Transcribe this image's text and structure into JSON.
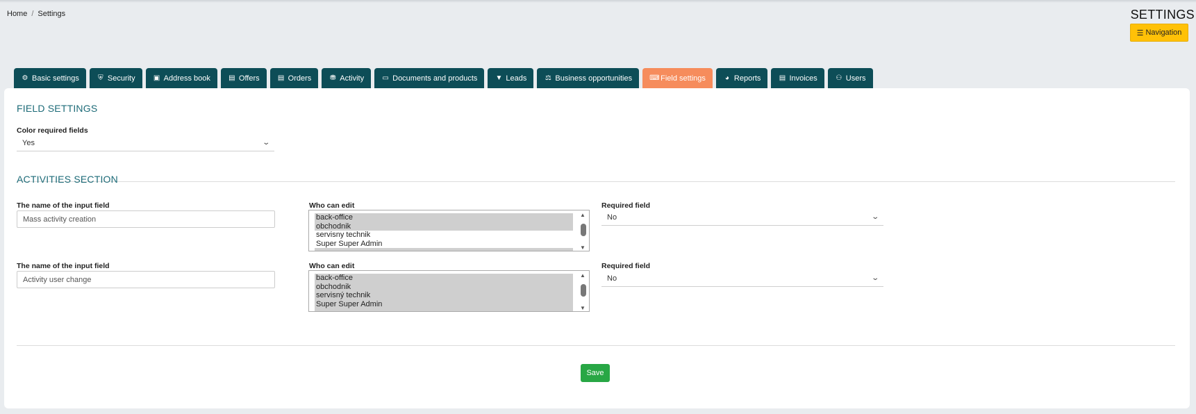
{
  "breadcrumb": {
    "home": "Home",
    "separator": "/",
    "current": "Settings"
  },
  "header": {
    "title": "SETTINGS",
    "nav_button": "Navigation",
    "nav_icon": "bars-icon"
  },
  "tabs": [
    {
      "label": "Basic settings",
      "icon": "gears-icon"
    },
    {
      "label": "Security",
      "icon": "shield-icon"
    },
    {
      "label": "Address book",
      "icon": "address-card-icon"
    },
    {
      "label": "Offers",
      "icon": "file-icon"
    },
    {
      "label": "Orders",
      "icon": "file-icon"
    },
    {
      "label": "Activity",
      "icon": "truck-icon"
    },
    {
      "label": "Documents and products",
      "icon": "folder-open-icon"
    },
    {
      "label": "Leads",
      "icon": "filter-icon"
    },
    {
      "label": "Business opportunities",
      "icon": "balance-scale-icon"
    },
    {
      "label": "Field settings",
      "icon": "keyboard-icon",
      "active": true
    },
    {
      "label": "Reports",
      "icon": "chart-pie-icon"
    },
    {
      "label": "Invoices",
      "icon": "file-icon"
    },
    {
      "label": "Users",
      "icon": "users-icon"
    }
  ],
  "field_settings": {
    "title": "FIELD SETTINGS",
    "color_required_label": "Color required fields",
    "color_required_value": "Yes"
  },
  "activities": {
    "title": "ACTIVITIES SECTION",
    "rows": [
      {
        "name_label": "The name of the input field",
        "name_value": "Mass activity creation",
        "who_label": "Who can edit",
        "who_options": [
          {
            "text": "back-office",
            "selected": true
          },
          {
            "text": "obchodnik",
            "selected": true
          },
          {
            "text": "servisny technik",
            "selected": false
          },
          {
            "text": "Super Super Admin",
            "selected": false
          }
        ],
        "required_label": "Required field",
        "required_value": "No"
      },
      {
        "name_label": "The name of the input field",
        "name_value": "Activity user change",
        "who_label": "Who can edit",
        "who_options": [
          {
            "text": "back-office",
            "selected": true
          },
          {
            "text": "obchodnik",
            "selected": true
          },
          {
            "text": "servisný technik",
            "selected": true
          },
          {
            "text": "Super Super Admin",
            "selected": true
          }
        ],
        "required_label": "Required field",
        "required_value": "No"
      }
    ]
  },
  "save_label": "Save",
  "colors": {
    "tab": "#0d4d57",
    "tab_active": "#f68c5c",
    "section_title": "#1d6b78",
    "nav_button": "#ffc107",
    "save_button": "#28a745"
  }
}
